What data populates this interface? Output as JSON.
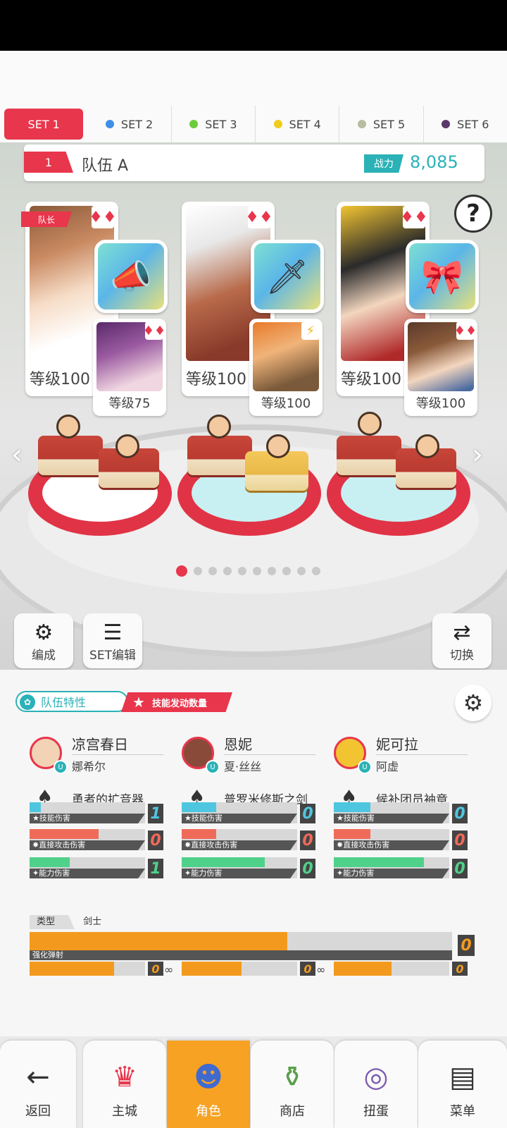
{
  "set_tabs": [
    {
      "label": "SET 1",
      "color": "#e8364c"
    },
    {
      "label": "SET 2",
      "color": "#3f8ee8"
    },
    {
      "label": "SET 3",
      "color": "#6dcc3a"
    },
    {
      "label": "SET 4",
      "color": "#f2cc1c"
    },
    {
      "label": "SET 5",
      "color": "#b8bca0"
    },
    {
      "label": "SET 6",
      "color": "#5a3a6a"
    }
  ],
  "team": {
    "number": "1",
    "name": "队伍 A",
    "power_label": "战力",
    "power": "8,085"
  },
  "leader_tag": "队长",
  "help": "?",
  "cards": [
    {
      "level": "等级100",
      "sub_level": "等级75",
      "suit": "♦♦",
      "sub_suit": "♦♦",
      "item_icon": "megaphone-icon"
    },
    {
      "level": "等级100",
      "sub_level": "等级100",
      "suit": "♦♦",
      "sub_suit": "⚡",
      "item_icon": "sword-icon"
    },
    {
      "level": "等级100",
      "sub_level": "等级100",
      "suit": "♦♦",
      "sub_suit": "♦♦",
      "item_icon": "armband-icon"
    }
  ],
  "nav_arrows": {
    "left": "‹",
    "right": "›"
  },
  "page_dots": {
    "count": 10,
    "active": 0
  },
  "side_buttons": {
    "formation": "编成",
    "set_edit": "SET编辑",
    "switch": "切换"
  },
  "panel": {
    "team_feature": "队伍特性",
    "skill_count": "技能发动数量",
    "members": [
      {
        "name": "凉宫春日",
        "sub": "娜希尔",
        "weapon": "勇者的扩音器",
        "stats": [
          {
            "label": "技能伤害",
            "value": "1",
            "fill": 0.1
          },
          {
            "label": "直接攻击伤害",
            "value": "0",
            "fill": 0.6
          },
          {
            "label": "能力伤害",
            "value": "1",
            "fill": 0.35
          }
        ]
      },
      {
        "name": "恩妮",
        "sub": "夏·丝丝",
        "weapon": "普罗米修斯之剑",
        "stats": [
          {
            "label": "技能伤害",
            "value": "0",
            "fill": 0.3
          },
          {
            "label": "直接攻击伤害",
            "value": "0",
            "fill": 0.3
          },
          {
            "label": "能力伤害",
            "value": "0",
            "fill": 0.72
          }
        ]
      },
      {
        "name": "妮可拉",
        "sub": "阿虚",
        "weapon": "候补团员袖章",
        "stats": [
          {
            "label": "技能伤害",
            "value": "0",
            "fill": 0.32
          },
          {
            "label": "直接攻击伤害",
            "value": "0",
            "fill": 0.32
          },
          {
            "label": "能力伤害",
            "value": "0",
            "fill": 0.78
          }
        ]
      }
    ],
    "type_label": "类型",
    "type_value": "剑士",
    "enhance_label": "强化弹射",
    "enhance_value": "0",
    "enhance_fill": 0.61,
    "mini_bars": [
      {
        "value": "0",
        "fill": 0.73
      },
      {
        "value": "0",
        "fill": 0.52
      },
      {
        "value": "0",
        "fill": 0.5
      }
    ],
    "stat_colors": {
      "skill": "#4fc6e0",
      "direct": "#f06a5a",
      "ability": "#4fd18a"
    }
  },
  "bottom_nav": [
    {
      "label": "返回",
      "icon": "back-arrow-icon"
    },
    {
      "label": "主城",
      "icon": "castle-icon"
    },
    {
      "label": "角色",
      "icon": "character-icon"
    },
    {
      "label": "商店",
      "icon": "shop-icon"
    },
    {
      "label": "扭蛋",
      "icon": "gacha-icon"
    },
    {
      "label": "菜单",
      "icon": "menu-list-icon"
    }
  ]
}
